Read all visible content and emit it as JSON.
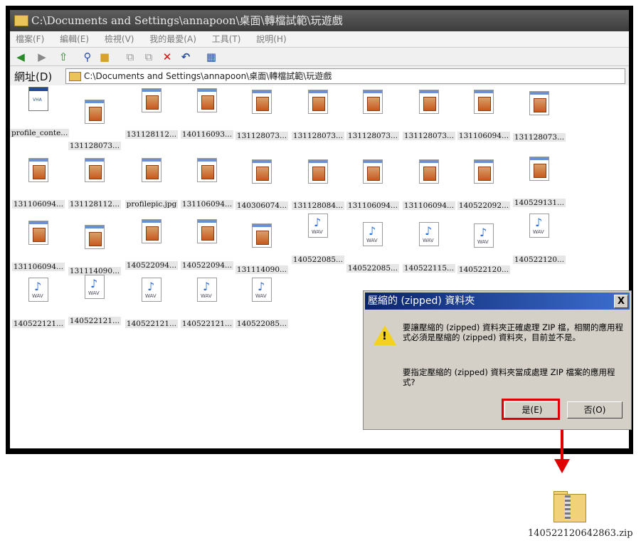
{
  "window": {
    "title": "C:\\Documents and Settings\\annapoon\\桌面\\轉檔試範\\玩遊戲"
  },
  "menu": [
    "檔案(F)",
    "編輯(E)",
    "檢視(V)",
    "我的最愛(A)",
    "工具(T)",
    "說明(H)"
  ],
  "address": {
    "label": "網址(D)",
    "value": "C:\\Documents and Settings\\annapoon\\桌面\\轉檔試範\\玩遊戲"
  },
  "files": [
    {
      "name": "profile_conte...",
      "type": "html"
    },
    {
      "name": "131128073...",
      "type": "image"
    },
    {
      "name": "131128112...",
      "type": "image"
    },
    {
      "name": "140116093...",
      "type": "image"
    },
    {
      "name": "131128073...",
      "type": "image"
    },
    {
      "name": "131128073...",
      "type": "image"
    },
    {
      "name": "131128073...",
      "type": "image"
    },
    {
      "name": "131128073...",
      "type": "image"
    },
    {
      "name": "131106094...",
      "type": "image"
    },
    {
      "name": "131128073...",
      "type": "image"
    },
    {
      "name": "131106094...",
      "type": "image"
    },
    {
      "name": "131128112...",
      "type": "image"
    },
    {
      "name": "profilepic.jpg",
      "type": "image"
    },
    {
      "name": "131106094...",
      "type": "image"
    },
    {
      "name": "140306074...",
      "type": "image"
    },
    {
      "name": "131128084...",
      "type": "image"
    },
    {
      "name": "131106094...",
      "type": "image"
    },
    {
      "name": "131106094...",
      "type": "image"
    },
    {
      "name": "140522092...",
      "type": "image"
    },
    {
      "name": "140529131...",
      "type": "image"
    },
    {
      "name": "131106094...",
      "type": "image"
    },
    {
      "name": "131114090...",
      "type": "image"
    },
    {
      "name": "140522094...",
      "type": "image"
    },
    {
      "name": "140522094...",
      "type": "image"
    },
    {
      "name": "131114090...",
      "type": "image"
    },
    {
      "name": "140522085...",
      "type": "wav"
    },
    {
      "name": "140522085...",
      "type": "wav"
    },
    {
      "name": "140522115...",
      "type": "wav"
    },
    {
      "name": "140522120...",
      "type": "wav"
    },
    {
      "name": "140522120...",
      "type": "wav"
    },
    {
      "name": "140522121...",
      "type": "wav"
    },
    {
      "name": "140522121...",
      "type": "wav"
    },
    {
      "name": "140522121...",
      "type": "wav"
    },
    {
      "name": "140522121...",
      "type": "wav"
    },
    {
      "name": "140522085...",
      "type": "wav"
    }
  ],
  "wav_label": "WAV",
  "dialog": {
    "title": "壓縮的 (zipped) 資料夾",
    "close": "X",
    "message1": "要讓壓縮的 (zipped) 資料夾正確處理 ZIP 檔，相關的應用程式必須是壓縮的 (zipped) 資料夾，目前並不是。",
    "message2": "要指定壓縮的 (zipped) 資料夾當成處理 ZIP 檔案的應用程式?",
    "yes_label": "是(E)",
    "no_label": "否(O)"
  },
  "zip_file": {
    "name": "140522120642863.zip"
  },
  "colors": {
    "highlight": "#e10000",
    "dialog_title": "#0a246a"
  }
}
